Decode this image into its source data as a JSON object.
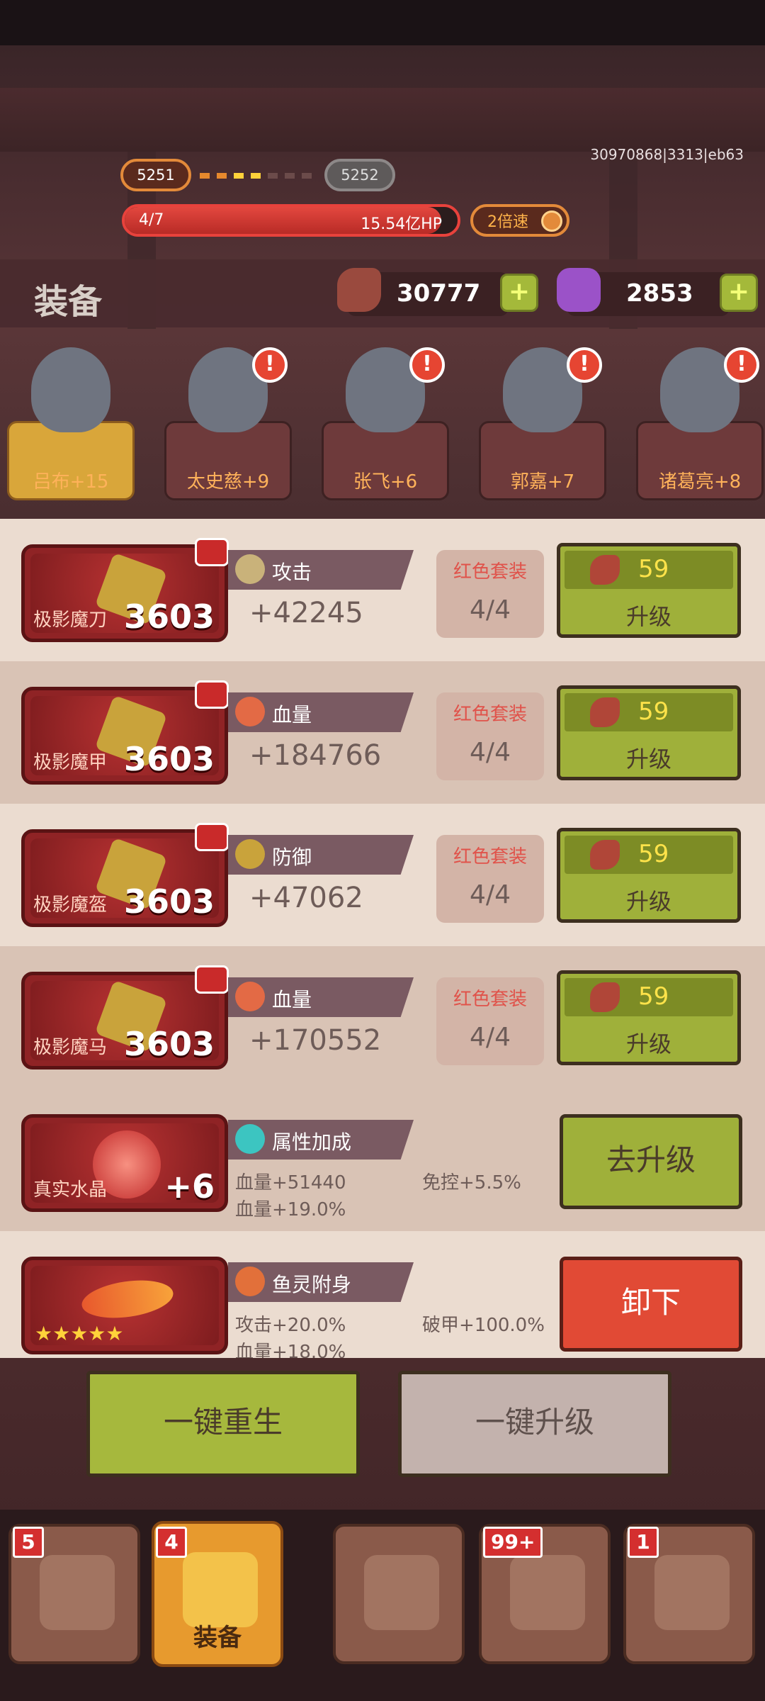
{
  "build_id": "30970868|3313|eb63",
  "stage": {
    "current": "5251",
    "next": "5252",
    "wave": "4/7",
    "hp": "15.54亿HP",
    "hp_fill_fraction": 0.95,
    "speed_label": "2倍速"
  },
  "header": {
    "title": "装备",
    "resource1": "30777",
    "resource2": "2853",
    "plus": "+"
  },
  "heroes": [
    {
      "name": "吕布+15",
      "active": true,
      "warn": false
    },
    {
      "name": "太史慈+9",
      "active": false,
      "warn": true
    },
    {
      "name": "张飞+6",
      "active": false,
      "warn": true
    },
    {
      "name": "郭嘉+7",
      "active": false,
      "warn": true
    },
    {
      "name": "诸葛亮+8",
      "active": false,
      "warn": true
    }
  ],
  "warn_glyph": "!",
  "equipment": [
    {
      "name": "极影魔刀",
      "level": "3603",
      "stat": "攻击",
      "value": "+42245",
      "set_title": "红色套装",
      "set_count": "4/4",
      "cost": "59",
      "button": "升级",
      "icon_color": "#d8c9a3"
    },
    {
      "name": "极影魔甲",
      "level": "3603",
      "stat": "血量",
      "value": "+184766",
      "set_title": "红色套装",
      "set_count": "4/4",
      "cost": "59",
      "button": "升级",
      "icon_color": "#e36a45"
    },
    {
      "name": "极影魔盔",
      "level": "3603",
      "stat": "防御",
      "value": "+47062",
      "set_title": "红色套装",
      "set_count": "4/4",
      "cost": "59",
      "button": "升级",
      "icon_color": "#c9a33b"
    },
    {
      "name": "极影魔马",
      "level": "3603",
      "stat": "血量",
      "value": "+170552",
      "set_title": "红色套装",
      "set_count": "4/4",
      "cost": "59",
      "button": "升级",
      "icon_color": "#e36a45"
    }
  ],
  "crystal": {
    "name": "真实水晶",
    "level": "+6",
    "stat": "属性加成",
    "line1": "血量+51440",
    "line2": "血量+19.0%",
    "line3": "免控+5.5%",
    "button": "去升级"
  },
  "fish": {
    "stat": "鱼灵附身",
    "stars": "★★★★★",
    "line1": "攻击+20.0%",
    "line2": "血量+18.0%",
    "line3": "破甲+100.0%",
    "button": "卸下"
  },
  "actions": {
    "rebirth": "一键重生",
    "upgrade_all": "一键升级"
  },
  "nav": [
    {
      "badge": "5",
      "label": "",
      "active": false
    },
    {
      "badge": "4",
      "label": "装备",
      "active": true
    },
    {
      "badge": "",
      "label": "",
      "active": false
    },
    {
      "badge": "99+",
      "label": "",
      "active": false
    },
    {
      "badge": "1",
      "label": "",
      "active": false
    }
  ]
}
